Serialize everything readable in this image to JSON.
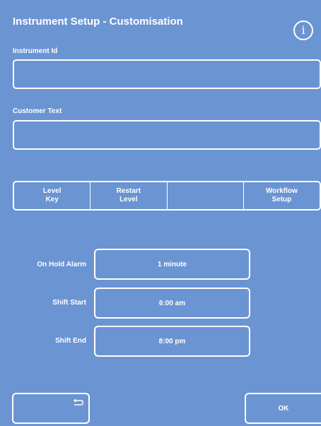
{
  "header": {
    "title": "Instrument Setup - Customisation",
    "info_icon": "info-icon",
    "info_glyph": "i"
  },
  "fields": {
    "instrument_id": {
      "label": "Instrument Id",
      "value": ""
    },
    "customer_text": {
      "label": "Customer Text",
      "value": ""
    }
  },
  "buttons_row": {
    "items": [
      {
        "label": "Level\nKey"
      },
      {
        "label": "Restart\nLevel"
      },
      {
        "label": ""
      },
      {
        "label": "Workflow\nSetup"
      }
    ]
  },
  "settings": {
    "on_hold_alarm": {
      "label": "On Hold Alarm",
      "value": "1 minute"
    },
    "shift_start": {
      "label": "Shift Start",
      "value": "6:00 am"
    },
    "shift_end": {
      "label": "Shift End",
      "value": "8:00 pm"
    }
  },
  "footer": {
    "back_icon": "back-arrow-icon",
    "ok_label": "OK"
  },
  "colors": {
    "background": "#6b94d2",
    "foreground": "#ffffff"
  }
}
